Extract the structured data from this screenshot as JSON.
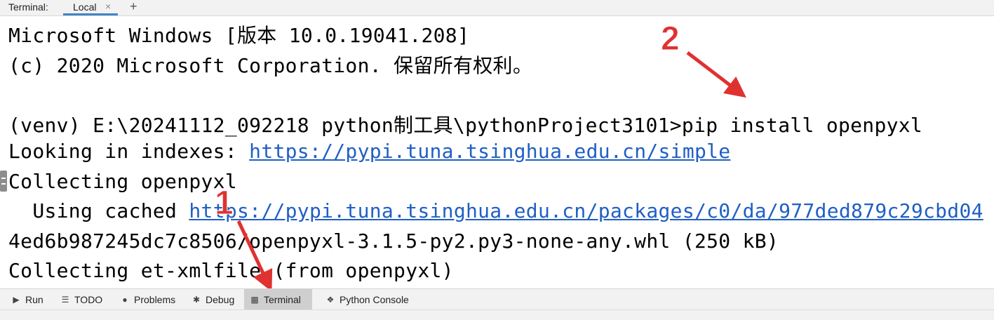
{
  "tabbar": {
    "title": "Terminal:",
    "tab_label": "Local",
    "close_glyph": "×",
    "plus_glyph": "+"
  },
  "terminal": {
    "lines": [
      "Microsoft Windows [版本 10.0.19041.208]",
      "(c) 2020 Microsoft Corporation. 保留所有权利。",
      "",
      "(venv) E:\\20241112_092218 python制工具\\pythonProject3101>pip install openpyxl",
      {
        "prefix": "Looking in indexes: ",
        "link": "https://pypi.tuna.tsinghua.edu.cn/simple"
      },
      "Collecting openpyxl",
      {
        "prefix": "  Using cached ",
        "link": "https://pypi.tuna.tsinghua.edu.cn/packages/c0/da/977ded879c29cbd04"
      },
      "4ed6b987245dc7c8506/openpyxl-3.1.5-py2.py3-none-any.whl (250 kB)",
      "Collecting et-xmlfile (from openpyxl)"
    ]
  },
  "annotations": {
    "label_1": "1",
    "label_2": "2",
    "color": "#e03131"
  },
  "bottombar": {
    "items": [
      {
        "label": "Run",
        "icon": "play-icon"
      },
      {
        "label": "TODO",
        "icon": "list-icon"
      },
      {
        "label": "Problems",
        "icon": "info-icon"
      },
      {
        "label": "Debug",
        "icon": "bug-icon"
      },
      {
        "label": "Terminal",
        "icon": "terminal-icon",
        "active": true
      },
      {
        "label": "Python Console",
        "icon": "python-icon"
      }
    ]
  }
}
